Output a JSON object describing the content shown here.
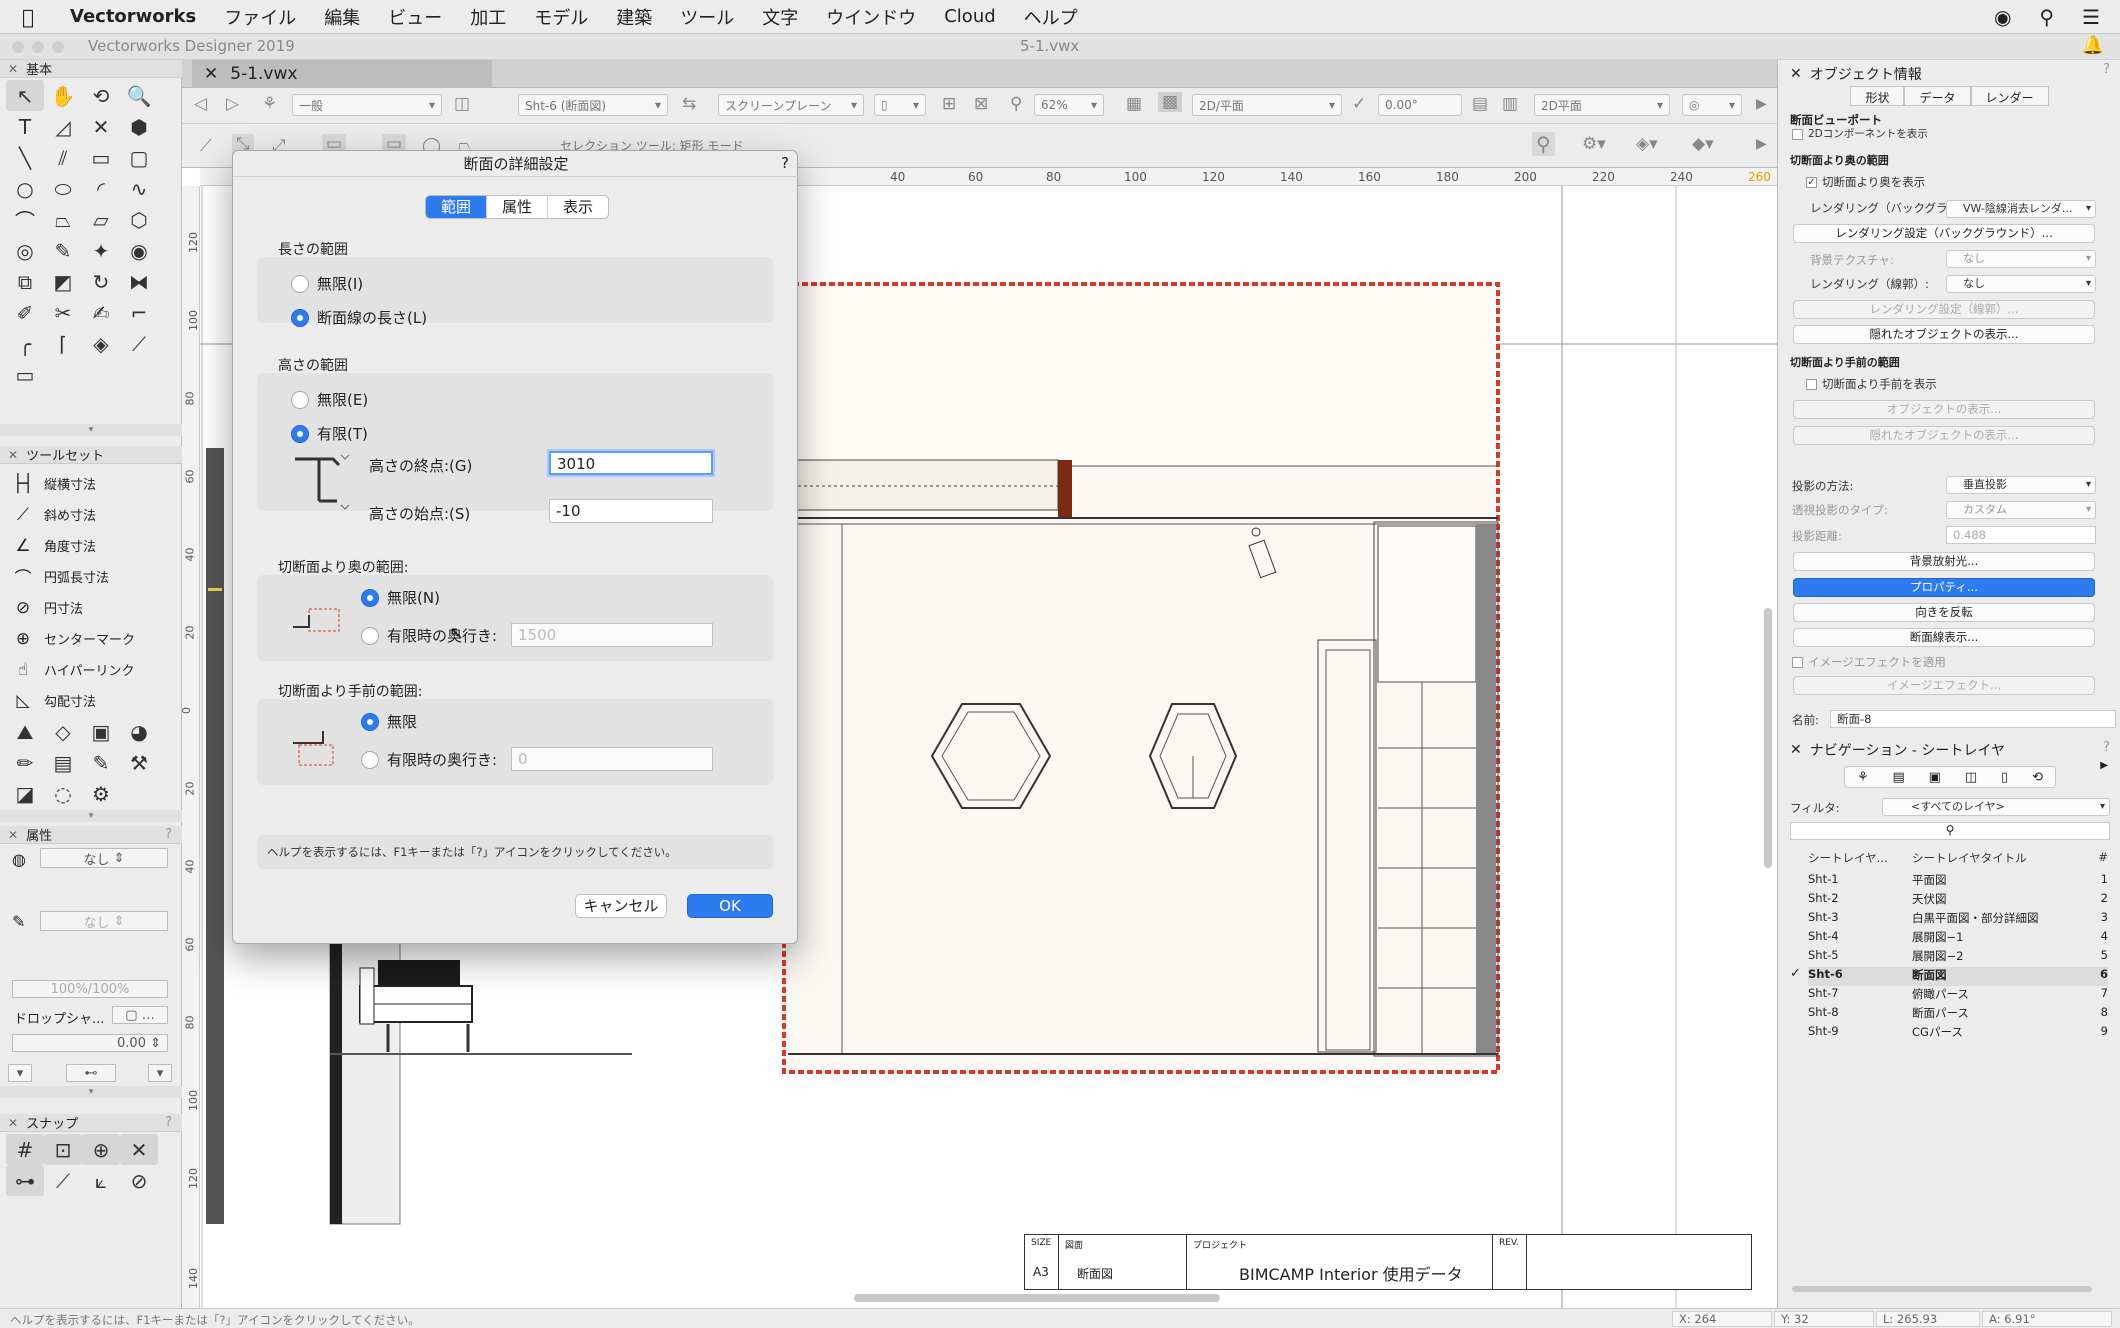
{
  "menubar": {
    "app": "Vectorworks",
    "items": [
      "ファイル",
      "編集",
      "ビュー",
      "加工",
      "モデル",
      "建築",
      "ツール",
      "文字",
      "ウインドウ",
      "Cloud",
      "ヘルプ"
    ]
  },
  "window": {
    "app_title": "Vectorworks Designer 2019",
    "doc_title": "5-1.vwx",
    "doc_tab": "5-1.vwx"
  },
  "viewbar": {
    "class_select": "一般",
    "sheet_select": "Sht-6 (断面図)",
    "plane_select": "スクリーンプレーン",
    "zoom": "62%",
    "view_select": "2D/平面",
    "angle": "0.00°",
    "render_select": "2D平面",
    "mode_text": "セレクション ツール: 矩形 モード"
  },
  "left_palette": {
    "basic_title": "基本",
    "toolset_title": "ツールセット",
    "dim_tools": [
      "縦横寸法",
      "斜め寸法",
      "角度寸法",
      "円弧長寸法",
      "円寸法",
      "センターマーク",
      "ハイパーリンク",
      "勾配寸法"
    ],
    "attr_title": "属性",
    "fill_value": "なし",
    "pen_value": "なし",
    "opacity": "100%/100%",
    "drop_shadow": "ドロップシャ...",
    "line_value": "0.00",
    "snap_title": "スナップ"
  },
  "ruler": {
    "h_ticks": [
      "40",
      "60",
      "80",
      "100",
      "120",
      "140",
      "160",
      "180",
      "200",
      "220",
      "240",
      "260"
    ],
    "v_ticks": [
      "120",
      "100",
      "80",
      "60",
      "40",
      "20",
      "0",
      "20",
      "40",
      "60",
      "80",
      "100",
      "120",
      "140"
    ]
  },
  "dialog": {
    "title": "断面の詳細設定",
    "help": "?",
    "tabs": [
      "範囲",
      "属性",
      "表示"
    ],
    "length_group": "長さの範囲",
    "length_opt1": "無限(I)",
    "length_opt2": "断面線の長さ(L)",
    "height_group": "高さの範囲",
    "height_opt1": "無限(E)",
    "height_opt2": "有限(T)",
    "height_end_label": "高さの終点:(G)",
    "height_end_value": "3010",
    "height_start_label": "高さの始点:(S)",
    "height_start_value": "-10",
    "back_group": "切断面より奥の範囲:",
    "back_opt1": "無限(N)",
    "back_opt2": "有限時の奥行き:",
    "back_depth": "1500",
    "front_group": "切断面より手前の範囲:",
    "front_opt1": "無限",
    "front_opt2": "有限時の奥行き:",
    "front_depth": "0",
    "help_text": "ヘルプを表示するには、F1キーまたは「?」アイコンをクリックしてください。",
    "cancel": "キャンセル",
    "ok": "OK"
  },
  "title_block": {
    "size_caption": "SIZE",
    "size": "A3",
    "drawing_caption": "図面",
    "drawing": "断面図",
    "project_caption": "プロジェクト",
    "project": "BIMCAMP Interior 使用データ",
    "rev_caption": "REV."
  },
  "object_info": {
    "title": "オブジェクト情報",
    "tabs": [
      "形状",
      "データ",
      "レンダー"
    ],
    "type": "断面ビューポート",
    "comp_2d": "2Dコンポーネントを表示",
    "sec_back": "切断面より奥の範囲",
    "show_back": "切断面より奥を表示",
    "render_bg_label": "レンダリング（バックグラ...",
    "render_bg_value": "VW-陰線消去レンダ...",
    "render_bg_settings": "レンダリング設定（バックグラウンド）...",
    "bg_texture_label": "背景テクスチャ:",
    "bg_texture_value": "なし",
    "render_line_label": "レンダリング（線郭）:",
    "render_line_value": "なし",
    "render_line_settings": "レンダリング設定（線郭）...",
    "hidden_objects": "隠れたオブジェクトの表示...",
    "sec_front": "切断面より手前の範囲",
    "show_front": "切断面より手前を表示",
    "object_display": "オブジェクトの表示...",
    "hidden_objects2": "隠れたオブジェクトの表示...",
    "projection_label": "投影の方法:",
    "projection_value": "垂直投影",
    "perspective_label": "透視投影のタイプ:",
    "perspective_value": "カスタム",
    "distance_label": "投影距離:",
    "distance_value": "0.488",
    "bg_light": "背景放射光...",
    "properties": "プロパティ...",
    "flip": "向きを反転",
    "section_line": "断面線表示...",
    "image_effect_apply": "イメージエフェクトを適用",
    "image_effect": "イメージエフェクト...",
    "name_label": "名前:",
    "name_value": "断面-8"
  },
  "navigation": {
    "title": "ナビゲーション - シートレイヤ",
    "filter_label": "フィルタ:",
    "filter_value": "<すべてのレイヤ>",
    "col1": "シートレイヤ...",
    "col2": "シートレイヤタイトル",
    "col3": "#",
    "rows": [
      {
        "id": "Sht-1",
        "title": "平面図",
        "n": "1"
      },
      {
        "id": "Sht-2",
        "title": "天伏図",
        "n": "2"
      },
      {
        "id": "Sht-3",
        "title": "白黒平面図・部分詳細図",
        "n": "3"
      },
      {
        "id": "Sht-4",
        "title": "展開図−1",
        "n": "4"
      },
      {
        "id": "Sht-5",
        "title": "展開図−2",
        "n": "5"
      },
      {
        "id": "Sht-6",
        "title": "断面図",
        "n": "6"
      },
      {
        "id": "Sht-7",
        "title": "俯瞰パース",
        "n": "7"
      },
      {
        "id": "Sht-8",
        "title": "断面パース",
        "n": "8"
      },
      {
        "id": "Sht-9",
        "title": "CGパース",
        "n": "9"
      }
    ],
    "active_check": "✓"
  },
  "status": {
    "help": "ヘルプを表示するには、F1キーまたは「?」アイコンをクリックしてください。",
    "x": "X: 264",
    "y": "Y: 32",
    "l": "L: 265.93",
    "a": "A: 6.91°"
  }
}
